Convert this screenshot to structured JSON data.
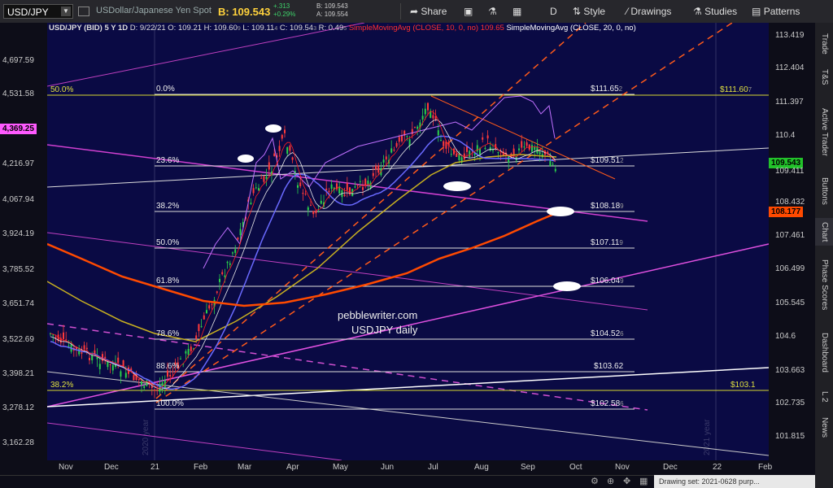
{
  "toolbar": {
    "symbol": "USD/JPY",
    "description": "USDollar/Japanese Yen Spot",
    "bid": "B: 109.543",
    "change": "+.313",
    "change_pct": "+0.29%",
    "bid_small": "B: 109.543",
    "ask_small": "A: 109.554",
    "share": "Share",
    "period": "D",
    "style": "Style",
    "drawings": "Drawings",
    "studies": "Studies",
    "patterns": "Patterns"
  },
  "header": {
    "symbol": "USD/JPY (BID) 5 Y 1D",
    "date": "D: 9/22/21",
    "open": "O: 109.21",
    "high": "H: 109.60",
    "high_sub": "9",
    "low": "L: 109.11",
    "low_sub": "4",
    "close": "C: 109.54",
    "close_sub": "3",
    "range": "R: 0.49",
    "range_sub": "5",
    "sma1": "SimpleMovingAvg (CLOSE, 10, 0, no)",
    "sma1_val": "109.65",
    "sma2": "SimpleMovingAvg (CLOSE, 20, 0, no)"
  },
  "left_axis": [
    "4,697.59",
    "4,531.58",
    "4,369.25",
    "4,216.97",
    "4,067.94",
    "3,924.19",
    "3,785.52",
    "3,651.74",
    "3,522.69",
    "3,398.21",
    "3,278.12",
    "3,162.28"
  ],
  "left_tag": "4,369.25",
  "right_axis": [
    "113.419",
    "112.404",
    "111.397",
    "110.4",
    "109.411",
    "108.432",
    "107.461",
    "106.499",
    "105.545",
    "104.6",
    "103.663",
    "102.735",
    "101.815"
  ],
  "right_tags": {
    "last": "109.543",
    "sma": "108.177"
  },
  "x_axis": [
    "Nov",
    "Dec",
    "21",
    "Feb",
    "Mar",
    "Apr",
    "May",
    "Jun",
    "Jul",
    "Aug",
    "Sep",
    "Oct",
    "Nov",
    "Dec",
    "22",
    "Feb"
  ],
  "fib_left": {
    "pct_50": "50.0%",
    "pct_382": "38.2%"
  },
  "fib_levels": [
    {
      "pct": "0.0%",
      "value": "$111.65",
      "sub": "2"
    },
    {
      "pct": "23.6%",
      "value": "$109.51",
      "sub": "2"
    },
    {
      "pct": "38.2%",
      "value": "$108.18",
      "sub": "9"
    },
    {
      "pct": "50.0%",
      "value": "$107.11",
      "sub": "9"
    },
    {
      "pct": "61.8%",
      "value": "$106.04",
      "sub": "9"
    },
    {
      "pct": "78.6%",
      "value": "$104.52",
      "sub": "6"
    },
    {
      "pct": "88.6%",
      "value": "$103.62",
      "sub": ""
    },
    {
      "pct": "100.0%",
      "value": "$102.58",
      "sub": "6"
    }
  ],
  "yellow_levels": [
    {
      "value": "$111.60",
      "sub": "7"
    },
    {
      "value": "$103.1",
      "sub": ""
    }
  ],
  "watermark": [
    "pebblewriter.com",
    "USDJPY daily"
  ],
  "year_labels": [
    "2020 year",
    "2021 year"
  ],
  "side_tabs": [
    "Trade",
    "T&S",
    "Active Trader",
    "Buttons",
    "Chart",
    "Phase Scores",
    "Dashboard",
    "L 2",
    "News"
  ],
  "status": "Drawing set: 2021-0628 purp...",
  "colors": {
    "chart_bg": "#0a0a44",
    "last_price": "#22c22a",
    "sma200": "#ff4a00",
    "bid": "#ffd23c"
  }
}
